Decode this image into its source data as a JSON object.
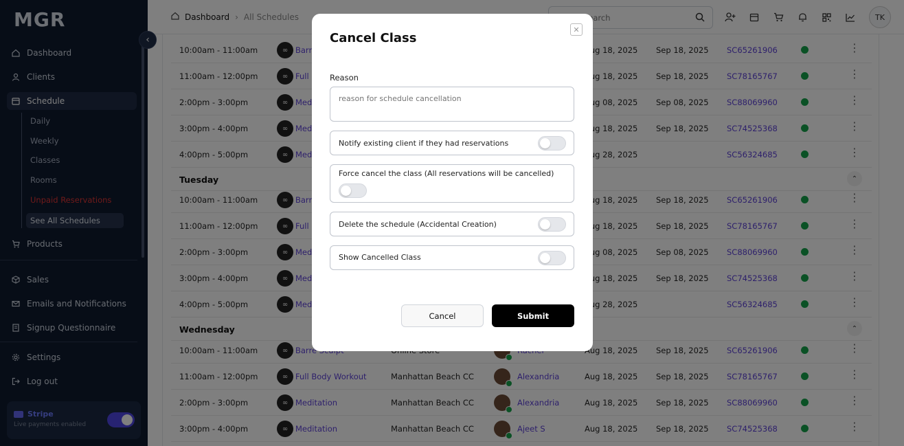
{
  "app": {
    "logo": "MGR"
  },
  "sidebar": {
    "items": [
      {
        "label": "Dashboard",
        "icon": "home-icon"
      },
      {
        "label": "Clients",
        "icon": "user-icon"
      },
      {
        "label": "Schedule",
        "icon": "calendar-icon"
      },
      {
        "label": "Products",
        "icon": "cart-icon"
      },
      {
        "label": "Sales",
        "icon": "box-icon"
      },
      {
        "label": "Emails and Notifications",
        "icon": "mail-icon"
      },
      {
        "label": "Signup Questionnaire",
        "icon": "document-icon"
      },
      {
        "label": "Settings",
        "icon": "gear-icon"
      },
      {
        "label": "Log out",
        "icon": "logout-icon"
      }
    ],
    "schedule_sub": [
      "Daily",
      "Weekly",
      "Classes",
      "Rooms",
      "Unpaid Reservations",
      "See All Schedules"
    ],
    "stripe": {
      "title": "Stripe",
      "subtitle": "Live payments enabled",
      "enabled": true
    }
  },
  "header": {
    "breadcrumb": [
      "Dashboard",
      "All Schedules"
    ],
    "search_placeholder": "Search",
    "avatar_initials": "TK"
  },
  "colors": {
    "sidebar_bg": "#0f1a2e",
    "accent": "#5b3fd6",
    "status_green": "#15a34a",
    "alert_red": "#e03535"
  },
  "table": {
    "rows_top": [
      {
        "time": "10:00am - 11:00am",
        "class": "Barre",
        "d1": "Aug 18, 2025",
        "d2": "Sep 18, 2025",
        "code": "SC65261906"
      },
      {
        "time": "11:00am - 12:00pm",
        "class": "Full B",
        "d1": "Aug 18, 2025",
        "d2": "Sep 18, 2025",
        "code": "SC78165767"
      },
      {
        "time": "2:00pm - 3:00pm",
        "class": "Medi",
        "d1": "Aug 08, 2025",
        "d2": "Sep 08, 2025",
        "code": "SC88069960"
      },
      {
        "time": "3:00pm - 4:00pm",
        "class": "Medi",
        "d1": "Aug 18, 2025",
        "d2": "Sep 18, 2025",
        "code": "SC74525368"
      },
      {
        "time": "4:00pm - 5:00pm",
        "class": "Medi",
        "d1": "Aug 28, 2025",
        "d2": "",
        "code": "SC56324685"
      }
    ],
    "day_tuesday": "Tuesday",
    "rows_tue": [
      {
        "time": "10:00am - 11:00am",
        "class": "Barre",
        "d1": "Aug 18, 2025",
        "d2": "Sep 18, 2025",
        "code": "SC65261906"
      },
      {
        "time": "11:00am - 12:00pm",
        "class": "Full B",
        "d1": "Aug 18, 2025",
        "d2": "Sep 18, 2025",
        "code": "SC78165767"
      },
      {
        "time": "2:00pm - 3:00pm",
        "class": "Medi",
        "d1": "Aug 08, 2025",
        "d2": "Sep 08, 2025",
        "code": "SC88069960"
      },
      {
        "time": "3:00pm - 4:00pm",
        "class": "Medi",
        "d1": "Aug 18, 2025",
        "d2": "Sep 18, 2025",
        "code": "SC74525368"
      },
      {
        "time": "4:00pm - 5:00pm",
        "class": "Medi",
        "d1": "Aug 28, 2025",
        "d2": "",
        "code": "SC56324685"
      }
    ],
    "day_wednesday": "Wednesday",
    "rows_wed": [
      {
        "time": "10:00am - 11:00am",
        "class": "Barre Sculpt",
        "location": "Online Store",
        "instructor": "Rachel",
        "d1": "Aug 18, 2025",
        "d2": "Sep 18, 2025",
        "code": "SC65261906"
      },
      {
        "time": "11:00am - 12:00pm",
        "class": "Full Body Workout",
        "location": "Manhattan Beach CC",
        "instructor": "Alexandria",
        "d1": "Aug 18, 2025",
        "d2": "Sep 18, 2025",
        "code": "SC78165767"
      },
      {
        "time": "2:00pm - 3:00pm",
        "class": "Meditation",
        "location": "Manhattan Beach CC",
        "instructor": "Alexandria",
        "d1": "Aug 18, 2025",
        "d2": "Sep 18, 2025",
        "code": "SC88069960"
      },
      {
        "time": "3:00pm - 4:00pm",
        "class": "Meditation",
        "location": "Manhattan Beach CC",
        "instructor": "Ajeet S",
        "d1": "Aug 18, 2025",
        "d2": "Sep 18, 2025",
        "code": "SC74525368"
      }
    ]
  },
  "modal": {
    "title": "Cancel Class",
    "reason_label": "Reason",
    "reason_placeholder": "reason for schedule cancellation",
    "options": [
      {
        "label": "Notify existing client if they had reservations",
        "enabled": false
      },
      {
        "label": "Force cancel the class (All reservations will be cancelled)",
        "enabled": false
      },
      {
        "label": "Delete the schedule (Accidental Creation)",
        "enabled": false
      },
      {
        "label": "Show Cancelled Class",
        "enabled": false
      }
    ],
    "cancel_label": "Cancel",
    "submit_label": "Submit"
  }
}
